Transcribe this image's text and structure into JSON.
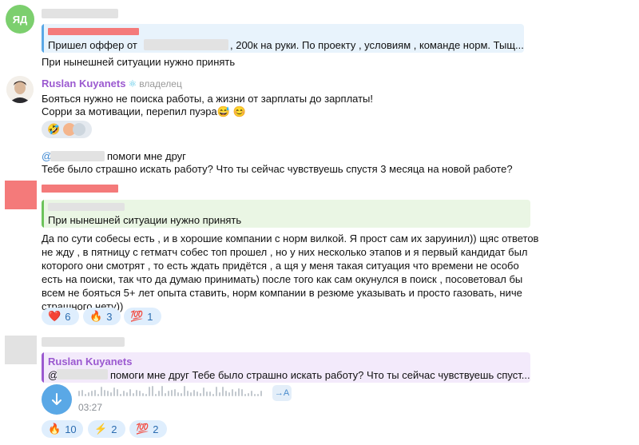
{
  "msg1": {
    "avatar_initials": "ЯД",
    "quote_text_before": "Пришел оффер от",
    "quote_text_after": ", 200к на руки. По проекту , условиям , команде норм. Тыщ...",
    "text": "При нынешней ситуации нужно принять"
  },
  "msg2": {
    "author": "Ruslan Kuyanets",
    "badge_icon": "react-atom-icon",
    "role": "владелец",
    "line1": "Бояться нужно не поиска работы, а жизни от зарплаты до зарплаты!",
    "line2": "Сорри за мотивации, перепил пуэра😅 😊",
    "reaction_emoji": "🤣"
  },
  "msg3": {
    "mention_prefix": "@",
    "mention_after": "помоги мне друг",
    "question": "Тебе было страшно искать работу? Что ты сейчас чувствуешь спустя 3 месяца на новой работе?"
  },
  "msg4": {
    "quote_text": "При нынешней ситуации нужно принять",
    "body_lines": [
      "Да по сути собесы есть , и в хорошие компании с норм вилкой. Я прост сам их заруинил)) щяс ответов",
      "не жду , в пятницу с гетматч собес топ прошел , но у них несколько этапов и я первый кандидат был",
      "которого они смотрят , то есть ждать придётся , а щя у меня такая ситуация что времени не особо",
      "есть на поиски, так что да думаю принимать) после того как сам окунулся в поиск , посоветовал бы",
      "всем не бояться 5+ лет опыта ставить, норм компании в резюме указывать и просто газовать, ниче",
      "страшного нету))"
    ],
    "reactions": [
      {
        "emoji": "❤️",
        "count": "6"
      },
      {
        "emoji": "🔥",
        "count": "3"
      },
      {
        "emoji": "💯",
        "count": "1"
      }
    ]
  },
  "msg5": {
    "quote_author": "Ruslan Kuyanets",
    "quote_mention": "@",
    "quote_after": "помоги мне друг  Тебе было страшно искать работу? Что ты сейчас чувствуешь спуст...",
    "voice_duration": "03:27",
    "transcribe_label": "→A",
    "download_icon": "download-arrow-icon",
    "reactions": [
      {
        "emoji": "🔥",
        "count": "10"
      },
      {
        "emoji": "⚡",
        "count": "2"
      },
      {
        "emoji": "💯",
        "count": "2"
      }
    ]
  },
  "colors": {
    "accent_blue": "#5aa8e6",
    "author_purple": "#9b59d0",
    "quote_blue_bg": "#e8f3fc",
    "quote_green_bg": "#eaf6e4",
    "quote_purple_bg": "#f3eafb",
    "reaction_bg": "#dfeefd"
  }
}
